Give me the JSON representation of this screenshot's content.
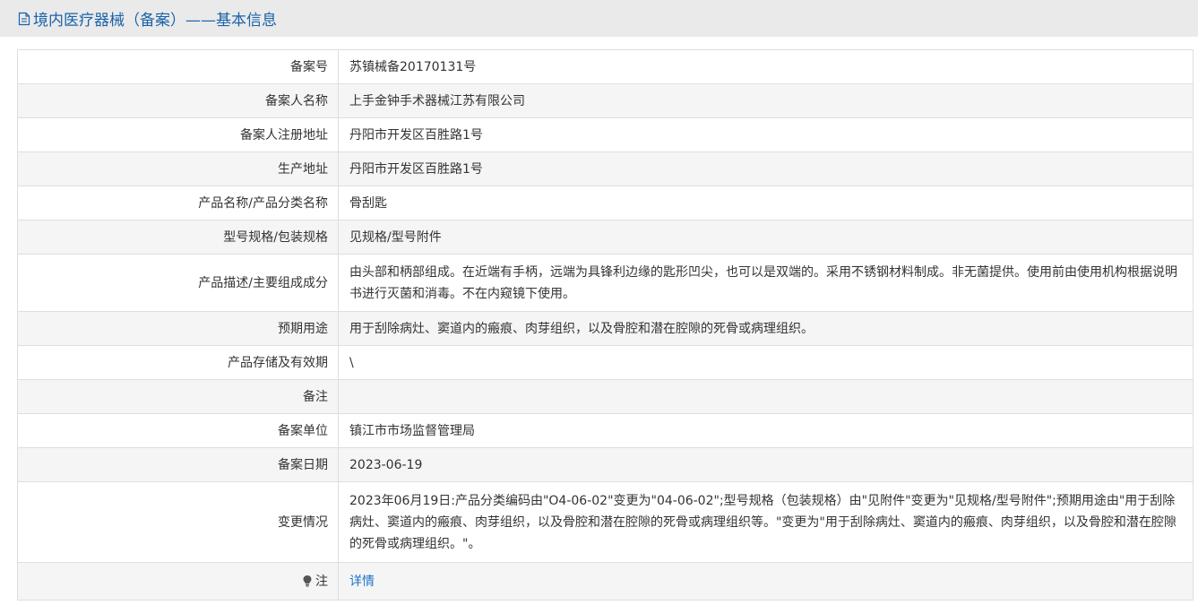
{
  "header": {
    "title": "境内医疗器械（备案）——基本信息",
    "icon": "document-icon",
    "title_color": "#1a63a8"
  },
  "rows": [
    {
      "label": "备案号",
      "value": "苏镇械备20170131号"
    },
    {
      "label": "备案人名称",
      "value": "上手金钟手术器械江苏有限公司"
    },
    {
      "label": "备案人注册地址",
      "value": "丹阳市开发区百胜路1号"
    },
    {
      "label": "生产地址",
      "value": "丹阳市开发区百胜路1号"
    },
    {
      "label": "产品名称/产品分类名称",
      "value": "骨刮匙"
    },
    {
      "label": "型号规格/包装规格",
      "value": "见规格/型号附件"
    },
    {
      "label": "产品描述/主要组成成分",
      "value": "由头部和柄部组成。在近端有手柄，远端为具锋利边缘的匙形凹尖，也可以是双端的。采用不锈钢材料制成。非无菌提供。使用前由使用机构根据说明书进行灭菌和消毒。不在内窥镜下使用。"
    },
    {
      "label": "预期用途",
      "value": "用于刮除病灶、窦道内的瘢痕、肉芽组织，以及骨腔和潜在腔隙的死骨或病理组织。"
    },
    {
      "label": "产品存储及有效期",
      "value": "\\"
    },
    {
      "label": "备注",
      "value": ""
    },
    {
      "label": "备案单位",
      "value": "镇江市市场监督管理局"
    },
    {
      "label": "备案日期",
      "value": "2023-06-19"
    },
    {
      "label": "变更情况",
      "value": "2023年06月19日:产品分类编码由\"O4-06-02\"变更为\"04-06-02\";型号规格（包装规格）由\"见附件\"变更为\"见规格/型号附件\";预期用途由\"用于刮除病灶、窦道内的瘢痕、肉芽组织，以及骨腔和潜在腔隙的死骨或病理组织等。\"变更为\"用于刮除病灶、窦道内的瘢痕、肉芽组织，以及骨腔和潜在腔隙的死骨或病理组织。\"。"
    }
  ],
  "note_row": {
    "label": "注",
    "icon": "lightbulb-icon",
    "link_text": "详情",
    "link_color": "#1a74c8"
  }
}
